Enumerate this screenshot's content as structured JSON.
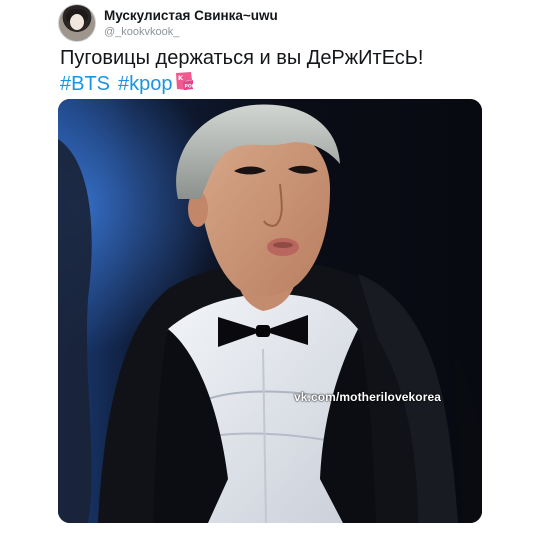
{
  "tweet": {
    "author": {
      "display_name": "Мускулистая Свинка~uwu",
      "handle": "@_kookvkook_"
    },
    "text": "Пуговицы держаться и вы ДеРжИтЕсЬ!",
    "hashtags": [
      "#BTS",
      "#kpop"
    ],
    "emoji": "kpop-badge-icon",
    "media": {
      "watermark": "vk.com/motherilovekorea"
    }
  },
  "colors": {
    "link": "#1b95e0",
    "text": "#14171a",
    "muted": "#8a949c"
  }
}
